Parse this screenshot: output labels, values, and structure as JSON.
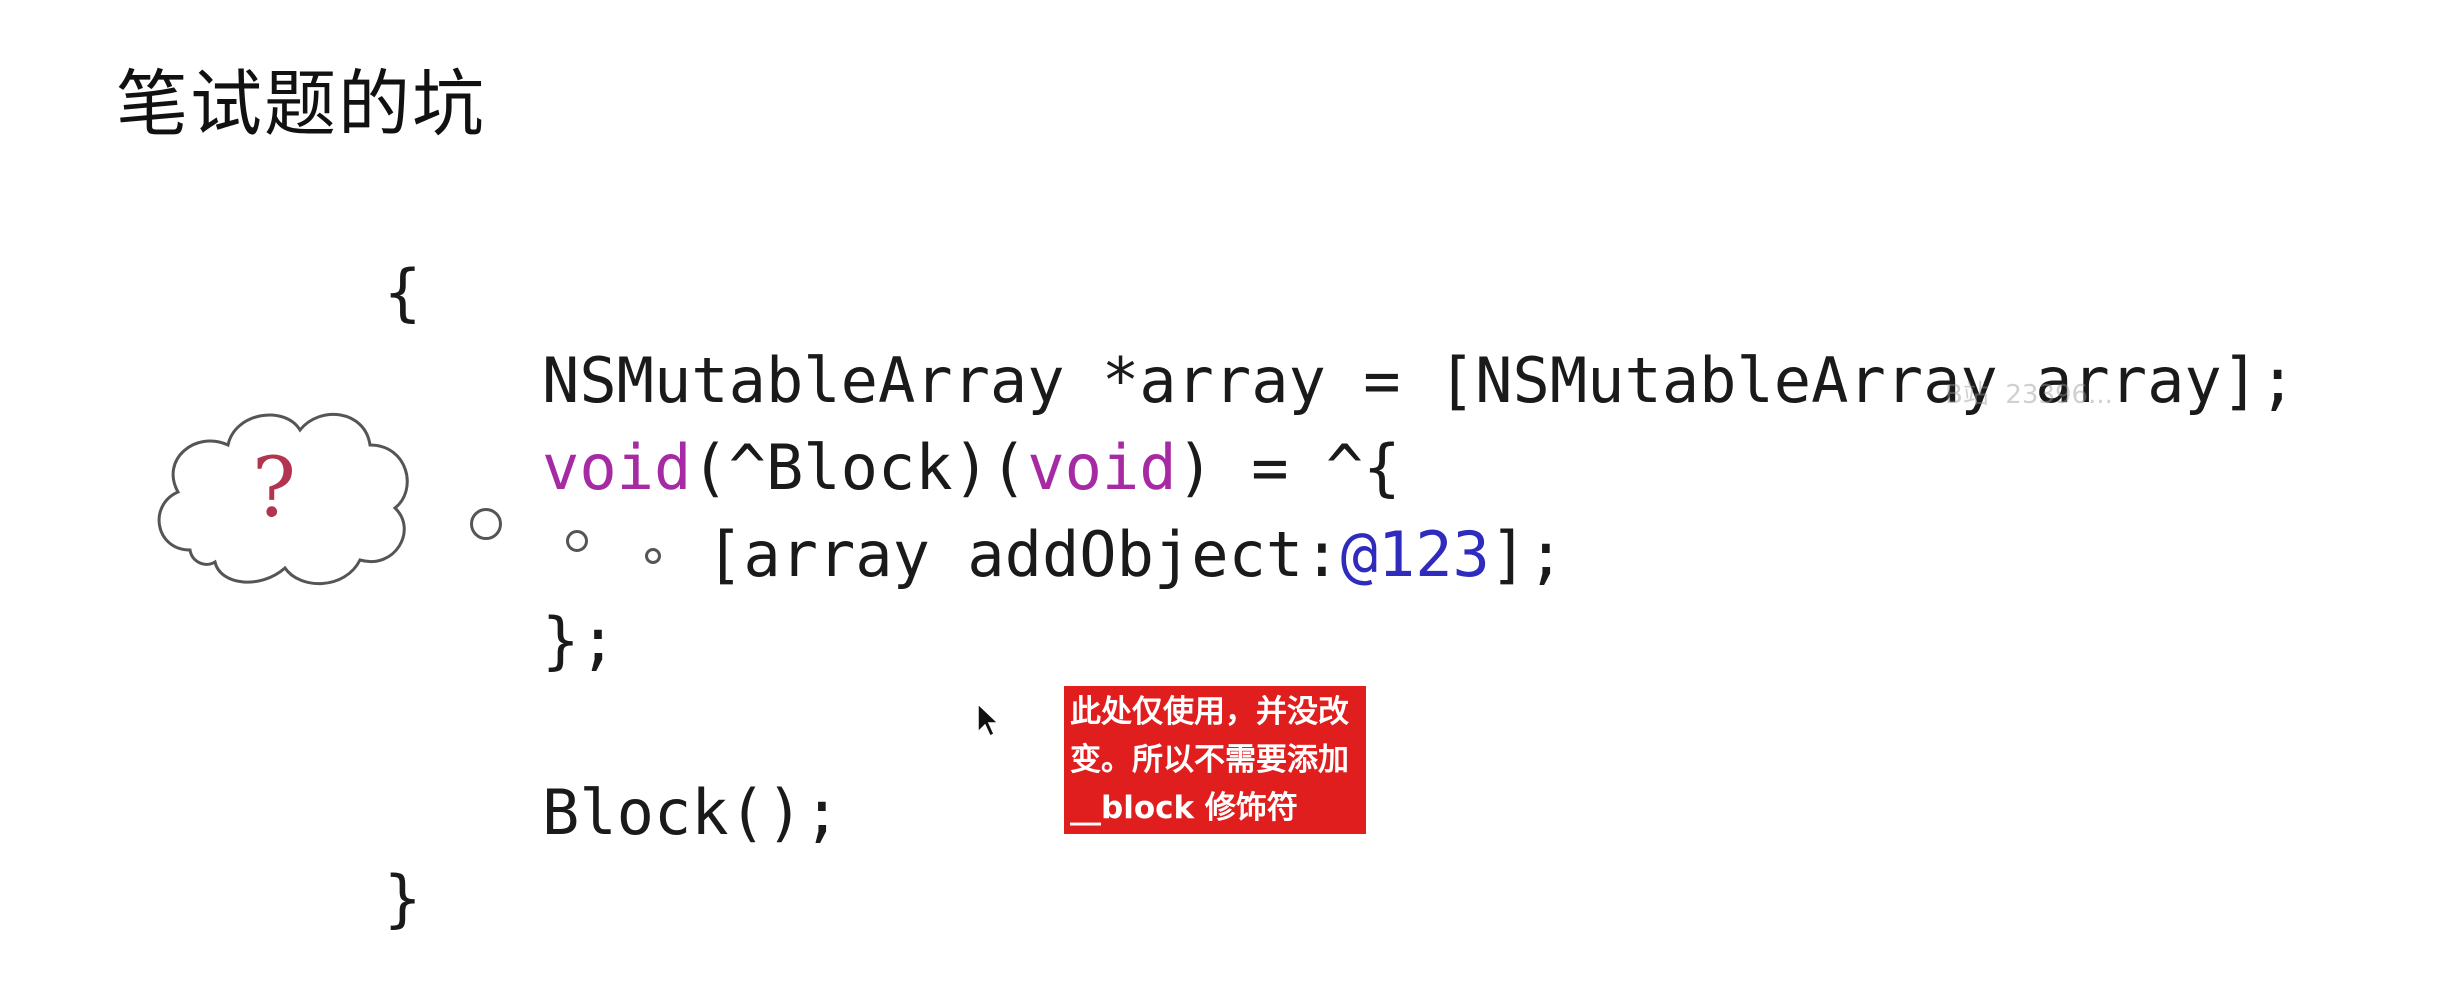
{
  "slide": {
    "title": "笔试题的坑",
    "code": {
      "open_brace": "{",
      "line1": "NSMutableArray *array = [NSMutableArray array];",
      "line2_kw1": "void",
      "line2_mid": "(^Block)(",
      "line2_kw2": "void",
      "line2_end": ") = ^{",
      "line3_pre": "[array addObject:",
      "line3_lit": "@123",
      "line3_end": "];",
      "line4": "};",
      "line5": "Block();",
      "close_brace": "}"
    },
    "thought_cloud": {
      "symbol": "?"
    },
    "annotation": "此处仅使用，并没改变。所以不需要添加__block 修饰符",
    "watermark": "B站  23396..."
  },
  "colors": {
    "keyword": "#a72aa5",
    "literal": "#2e2bbd",
    "annotation_bg": "#e01e1e",
    "question_mark": "#b2344f"
  }
}
